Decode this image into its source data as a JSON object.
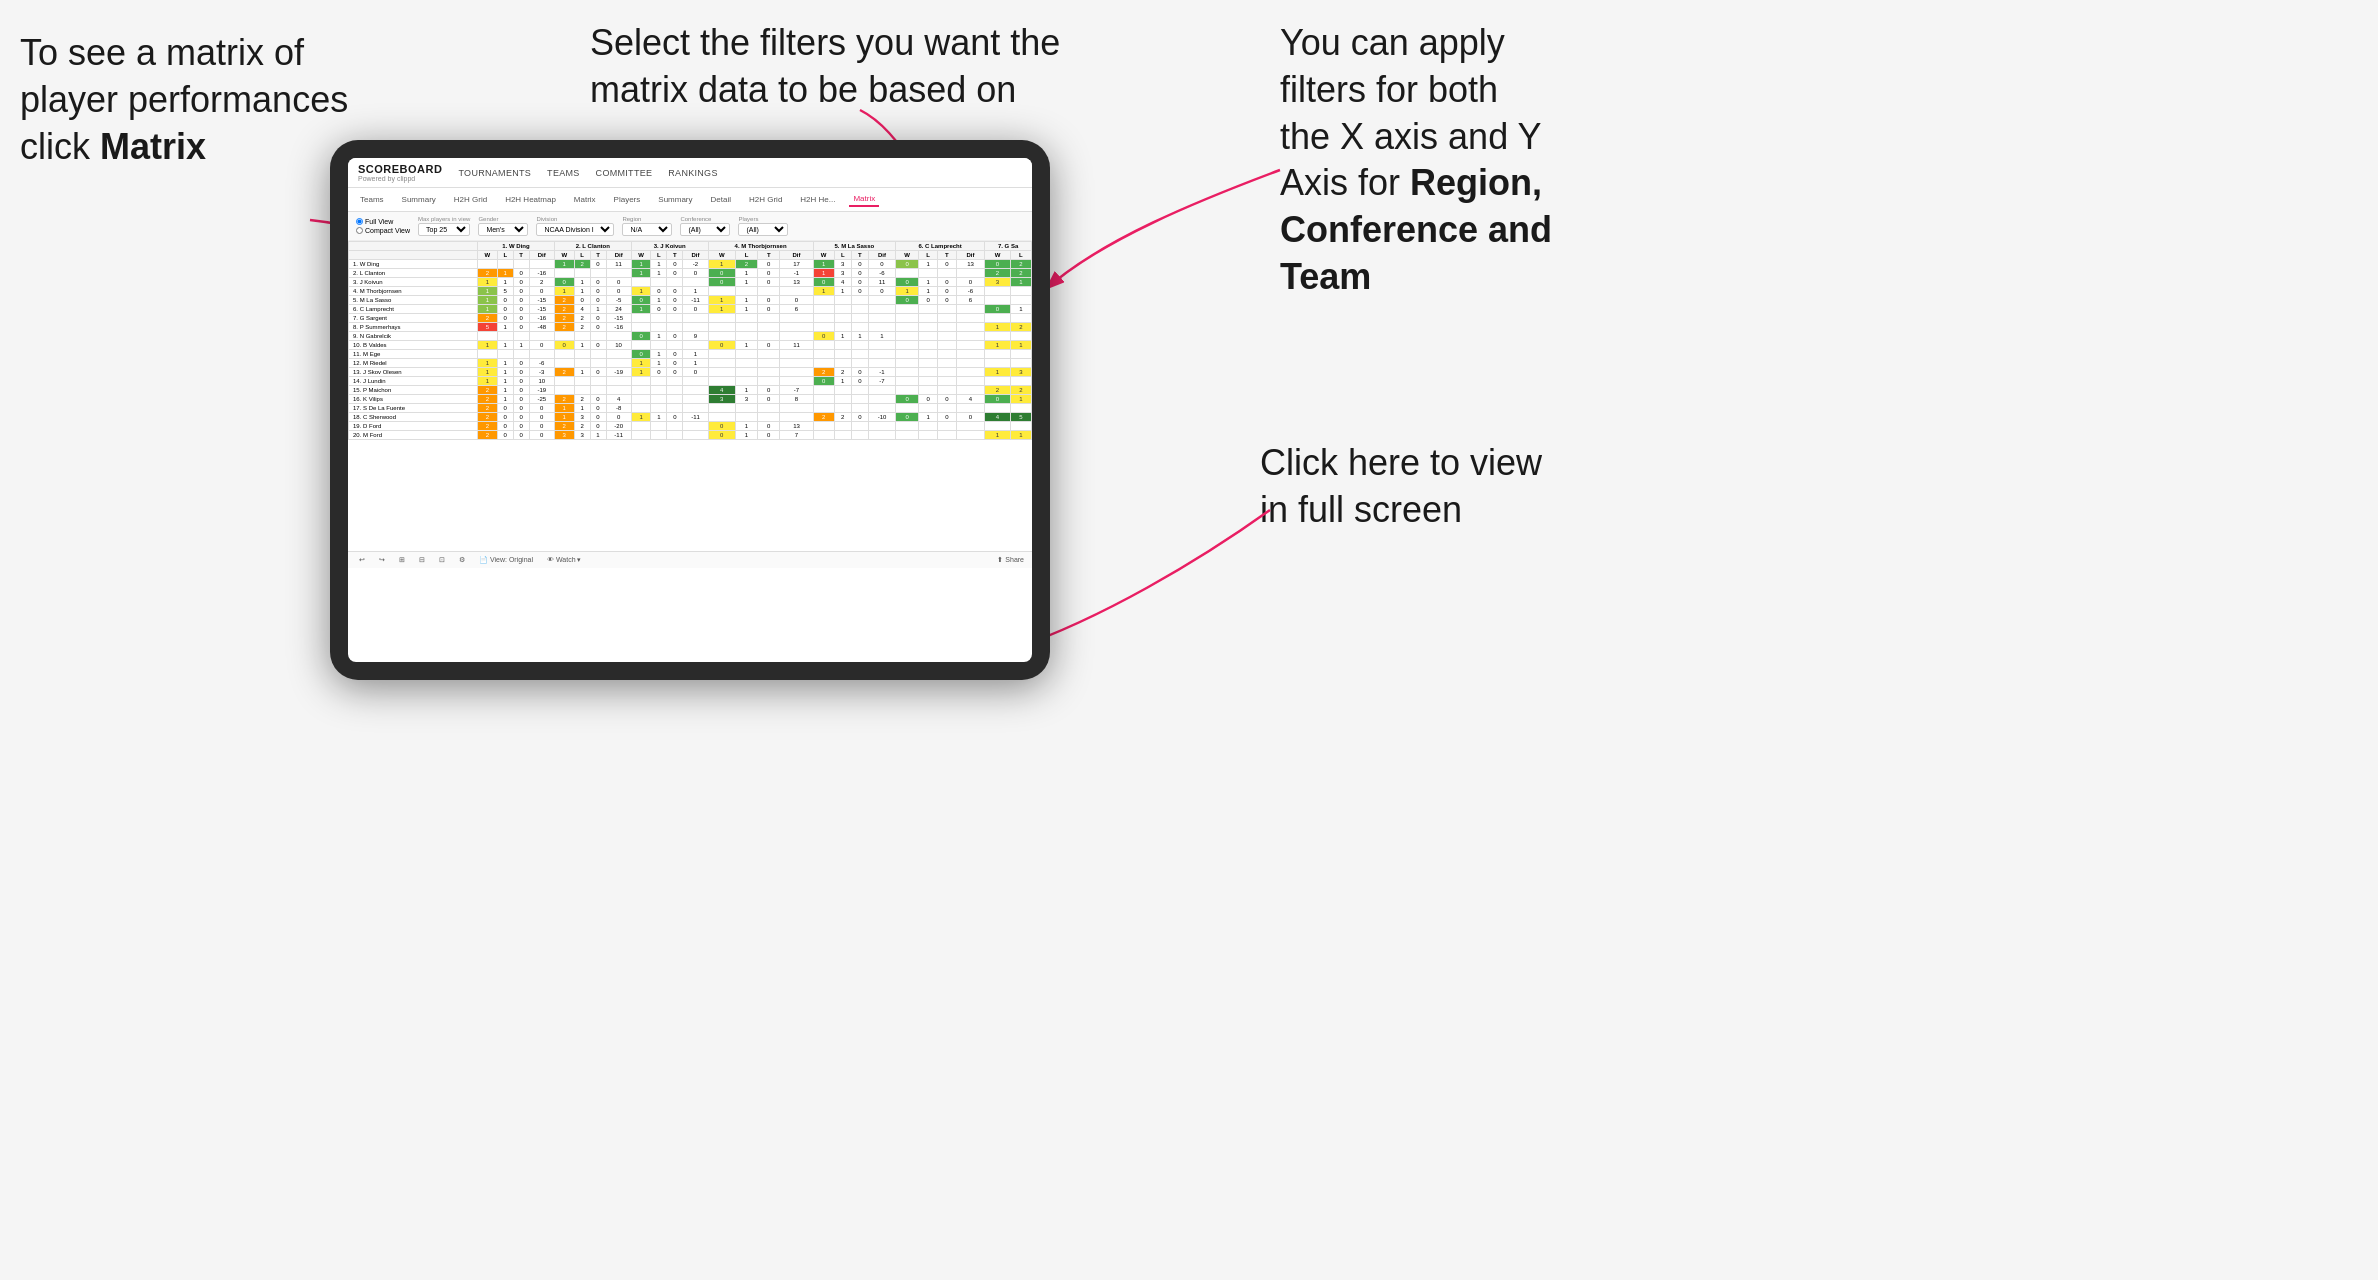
{
  "annotations": {
    "topleft": {
      "line1": "To see a matrix of",
      "line2": "player performances",
      "line3_normal": "click ",
      "line3_bold": "Matrix"
    },
    "topmid": {
      "text": "Select the filters you want the matrix data to be based on"
    },
    "topright": {
      "line1": "You  can apply",
      "line2": "filters for both",
      "line3": "the X axis and Y",
      "line4_normal": "Axis for ",
      "line4_bold": "Region,",
      "line5_bold": "Conference and",
      "line6_bold": "Team"
    },
    "bottomright": {
      "line1": "Click here to view",
      "line2": "in full screen"
    }
  },
  "app": {
    "logo_title": "SCOREBOARD",
    "logo_sub": "Powered by clippd",
    "nav": [
      "TOURNAMENTS",
      "TEAMS",
      "COMMITTEE",
      "RANKINGS"
    ],
    "subnav": [
      "Teams",
      "Summary",
      "H2H Grid",
      "H2H Heatmap",
      "Matrix",
      "Players",
      "Summary",
      "Detail",
      "H2H Grid",
      "H2H He...",
      "Matrix"
    ],
    "active_subnav": "Matrix",
    "filters": {
      "view_options": [
        "Full View",
        "Compact View"
      ],
      "max_players_label": "Max players in view",
      "max_players_value": "Top 25",
      "gender_label": "Gender",
      "gender_value": "Men's",
      "division_label": "Division",
      "division_value": "NCAA Division I",
      "region_label": "Region",
      "region_value": "N/A",
      "conference_label": "Conference",
      "conference_value": "(All)",
      "players_label": "Players",
      "players_value": "(All)"
    },
    "column_headers": [
      "1. W Ding",
      "2. L Clanton",
      "3. J Koivun",
      "4. M Thorbjornsen",
      "5. M La Sasso",
      "6. C Lamprecht",
      "7. G Sa"
    ],
    "sub_headers": [
      "W",
      "L",
      "T",
      "Dif"
    ],
    "players": [
      "1. W Ding",
      "2. L Clanton",
      "3. J Koivun",
      "4. M Thorbjornsen",
      "5. M La Sasso",
      "6. C Lamprecht",
      "7. G Sargent",
      "8. P Summerhays",
      "9. N Gabrelcik",
      "10. B Valdes",
      "11. M Ege",
      "12. M Riedel",
      "13. J Skov Olesen",
      "14. J Lundin",
      "15. P Maichon",
      "16. K Vilips",
      "17. S De La Fuente",
      "18. C Sherwood",
      "19. D Ford",
      "20. M Ford"
    ],
    "footer": {
      "undo": "↩",
      "redo": "↪",
      "tools": "⊞ ⊟ ⊡",
      "view_label": "View: Original",
      "watch_label": "Watch ▾",
      "share_label": "Share"
    }
  }
}
